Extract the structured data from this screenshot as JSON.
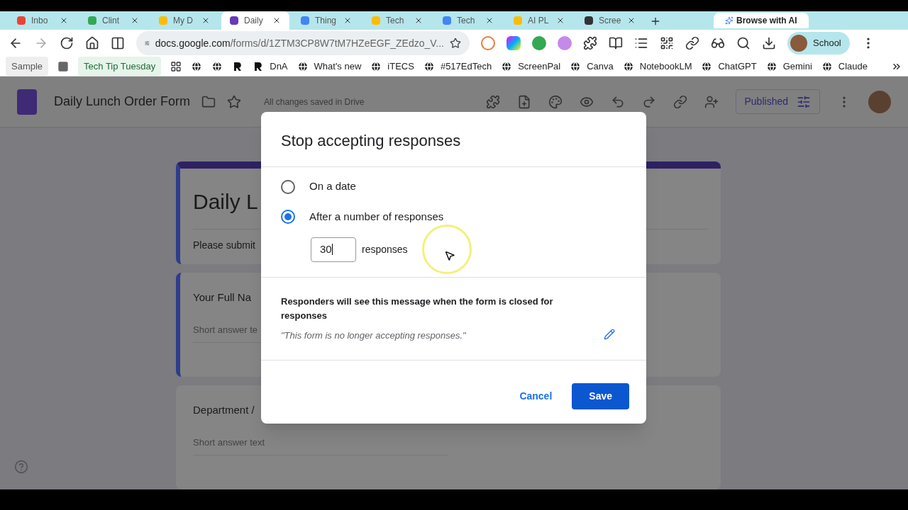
{
  "browser": {
    "tabs": [
      {
        "label": "Inbo",
        "selected": false,
        "color": "#ea4335"
      },
      {
        "label": "Clint",
        "selected": false,
        "color": "#34a853"
      },
      {
        "label": "My D",
        "selected": false,
        "color": "#fbbc04"
      },
      {
        "label": "Daily",
        "selected": true,
        "color": "#673ab7"
      },
      {
        "label": "Thing",
        "selected": false,
        "color": "#4285f4"
      },
      {
        "label": "Tech",
        "selected": false,
        "color": "#fbbc04"
      },
      {
        "label": "Tech",
        "selected": false,
        "color": "#4285f4"
      },
      {
        "label": "AI PL",
        "selected": false,
        "color": "#fbbc04"
      },
      {
        "label": "Scree",
        "selected": false,
        "color": "#333333"
      }
    ],
    "browse_ai": "Browse with AI",
    "url_host": "docs.google.com",
    "url_path": "/forms/d/1ZTM3CP8W7tM7HZeEGF_ZEdzo_V...",
    "profile": "School",
    "bookmarks": [
      {
        "kind": "chip",
        "label": "Sample",
        "color": "#eeeeee"
      },
      {
        "kind": "square"
      },
      {
        "kind": "chip",
        "label": "Tech Tip Tuesday",
        "color": "#e6f4ea"
      },
      {
        "kind": "apps"
      },
      {
        "kind": "globe"
      },
      {
        "kind": "globe"
      },
      {
        "kind": "r"
      },
      {
        "kind": "r",
        "label": "DnA"
      },
      {
        "kind": "globe",
        "label": "What's new"
      },
      {
        "kind": "globe",
        "label": "iTECS"
      },
      {
        "kind": "globe",
        "label": "#517EdTech"
      },
      {
        "kind": "globe",
        "label": "ScreenPal"
      },
      {
        "kind": "globe",
        "label": "Canva"
      },
      {
        "kind": "globe",
        "label": "NotebookLM"
      },
      {
        "kind": "globe",
        "label": "ChatGPT"
      },
      {
        "kind": "globe",
        "label": "Gemini"
      },
      {
        "kind": "globe",
        "label": "Claude"
      }
    ]
  },
  "forms": {
    "title": "Daily Lunch Order Form",
    "status": "All changes saved in Drive",
    "published": "Published",
    "form_title": "Daily L",
    "form_description": "Please submit",
    "questions": [
      {
        "title": "Your Full Na",
        "placeholder": "Short answer te",
        "selected": true
      },
      {
        "title": "Department /",
        "placeholder": "Short answer text",
        "selected": false
      }
    ]
  },
  "dialog": {
    "title": "Stop accepting responses",
    "options": [
      {
        "label": "On a date",
        "selected": false
      },
      {
        "label": "After a number of responses",
        "selected": true
      }
    ],
    "count": "30",
    "count_unit": "responses",
    "message_label": "Responders will see this message when the form is closed for responses",
    "message": "\"This form is no longer accepting responses.\"",
    "cancel": "Cancel",
    "save": "Save"
  }
}
